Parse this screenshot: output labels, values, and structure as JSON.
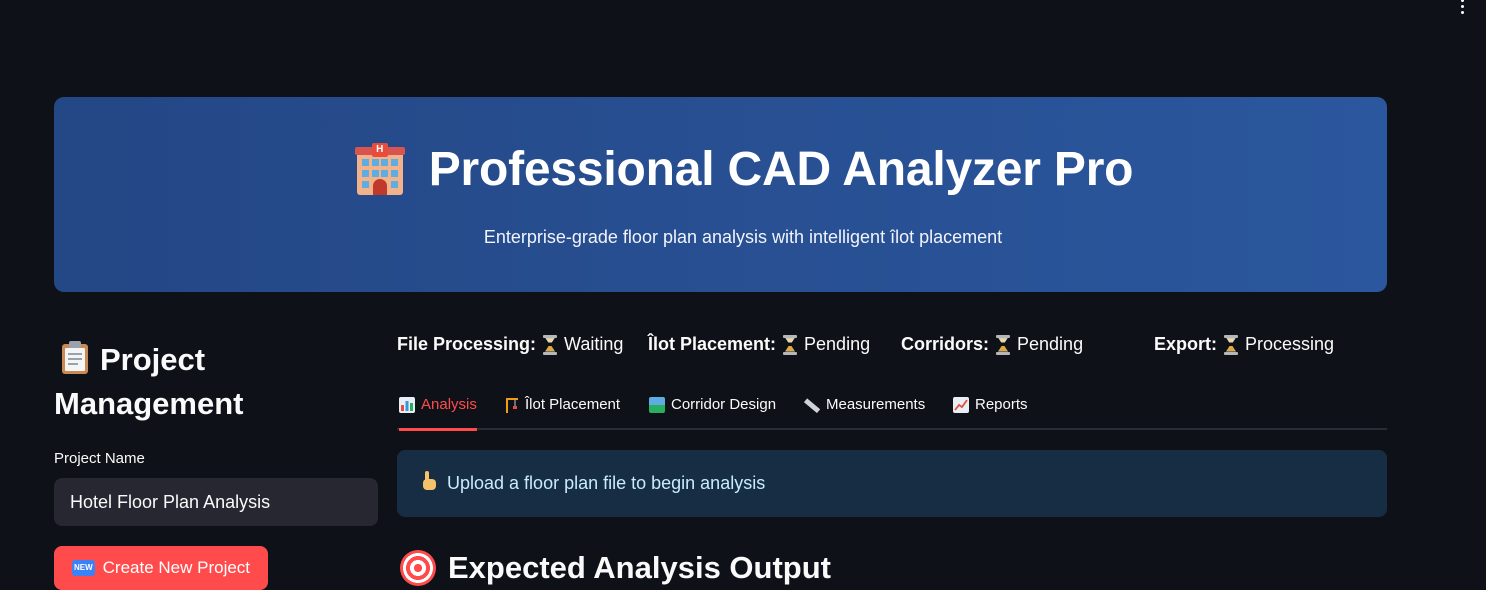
{
  "menu": {
    "icon": "kebab-menu-icon"
  },
  "hero": {
    "icon": "hotel-icon",
    "title": "Professional CAD Analyzer Pro",
    "subtitle": "Enterprise-grade floor plan analysis with intelligent îlot placement",
    "gradient_start": "#244785",
    "gradient_end": "#2b579e"
  },
  "sidebar": {
    "section_icon": "clipboard-icon",
    "section_title": "Project Management",
    "project_name_label": "Project Name",
    "project_name_value": "Hotel Floor Plan Analysis",
    "create_button_icon": "new-badge-icon",
    "create_button_badge": "NEW",
    "create_button_label": "Create New Project"
  },
  "status": [
    {
      "label": "File Processing:",
      "icon": "hourglass-icon",
      "value": "Waiting"
    },
    {
      "label": "Îlot Placement:",
      "icon": "hourglass-icon",
      "value": "Pending"
    },
    {
      "label": "Corridors:",
      "icon": "hourglass-icon",
      "value": "Pending"
    },
    {
      "label": "Export:",
      "icon": "hourglass-icon",
      "value": "Processing"
    }
  ],
  "tabs": [
    {
      "icon": "bar-chart-icon",
      "label": "Analysis",
      "active": true
    },
    {
      "icon": "crane-icon",
      "label": "Îlot Placement",
      "active": false
    },
    {
      "icon": "landscape-icon",
      "label": "Corridor Design",
      "active": false
    },
    {
      "icon": "ruler-icon",
      "label": "Measurements",
      "active": false
    },
    {
      "icon": "trend-chart-icon",
      "label": "Reports",
      "active": false
    }
  ],
  "info": {
    "icon": "pointing-up-icon",
    "message": "Upload a floor plan file to begin analysis"
  },
  "section": {
    "icon": "target-icon",
    "title": "Expected Analysis Output"
  },
  "colors": {
    "background": "#0e1117",
    "accent": "#ff4b4b",
    "info_bg": "#172d43",
    "input_bg": "#262730"
  }
}
